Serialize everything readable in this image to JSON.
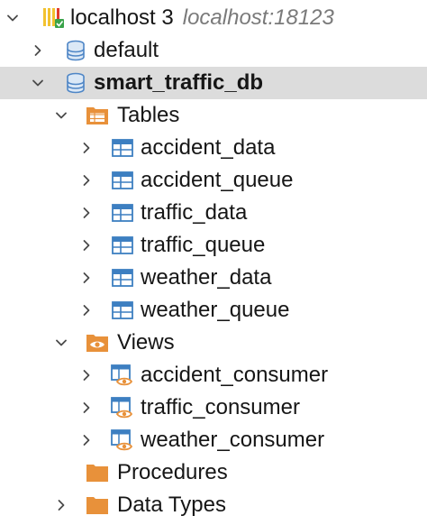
{
  "tree": {
    "connection": {
      "label": "localhost 3",
      "host": "localhost:18123",
      "icon": "server-connection-icon",
      "expanded": true
    },
    "databases": [
      {
        "label": "default",
        "icon": "database-icon",
        "expanded": false
      },
      {
        "label": "smart_traffic_db",
        "icon": "database-icon",
        "expanded": true,
        "selected": true
      }
    ],
    "tables_folder": {
      "label": "Tables",
      "icon": "tables-folder-icon",
      "expanded": true
    },
    "tables": [
      {
        "label": "accident_data",
        "icon": "table-icon"
      },
      {
        "label": "accident_queue",
        "icon": "table-icon"
      },
      {
        "label": "traffic_data",
        "icon": "table-icon"
      },
      {
        "label": "traffic_queue",
        "icon": "table-icon"
      },
      {
        "label": "weather_data",
        "icon": "table-icon"
      },
      {
        "label": "weather_queue",
        "icon": "table-icon"
      }
    ],
    "views_folder": {
      "label": "Views",
      "icon": "views-folder-icon",
      "expanded": true
    },
    "views": [
      {
        "label": "accident_consumer",
        "icon": "view-icon"
      },
      {
        "label": "traffic_consumer",
        "icon": "view-icon"
      },
      {
        "label": "weather_consumer",
        "icon": "view-icon"
      }
    ],
    "procedures_folder": {
      "label": "Procedures",
      "icon": "folder-icon"
    },
    "data_types_folder": {
      "label": "Data Types",
      "icon": "folder-icon",
      "expanded": false
    }
  },
  "colors": {
    "selection": "#dcdcdc",
    "folder_orange": "#e8913a",
    "table_blue": "#3d7fc1",
    "db_blue": "#4f86c6"
  }
}
